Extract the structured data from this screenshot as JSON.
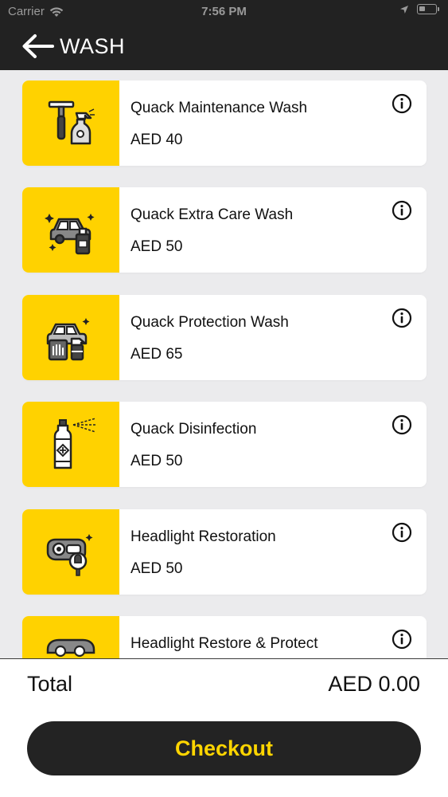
{
  "status_bar": {
    "carrier": "Carrier",
    "time": "7:56 PM"
  },
  "nav": {
    "title": "WASH"
  },
  "colors": {
    "header_bg": "#222222",
    "accent_yellow": "#ffd200",
    "page_bg": "#ebebed",
    "checkout_text": "#ffd500"
  },
  "services": [
    {
      "icon": "squeegee-spray-icon",
      "title": "Quack Maintenance Wash",
      "price": "AED 40"
    },
    {
      "icon": "car-sparkle-bottle-icon",
      "title": "Quack Extra Care Wash",
      "price": "AED 50"
    },
    {
      "icon": "car-protection-icon",
      "title": "Quack Protection Wash",
      "price": "AED 65"
    },
    {
      "icon": "disinfectant-spray-icon",
      "title": "Quack Disinfection",
      "price": "AED 50"
    },
    {
      "icon": "headlight-restoration-icon",
      "title": "Headlight Restoration",
      "price": "AED 50"
    },
    {
      "icon": "headlight-protect-icon",
      "title": "Headlight Restore & Protect",
      "price": ""
    }
  ],
  "footer": {
    "total_label": "Total",
    "total_value": "AED 0.00",
    "checkout_label": "Checkout"
  }
}
